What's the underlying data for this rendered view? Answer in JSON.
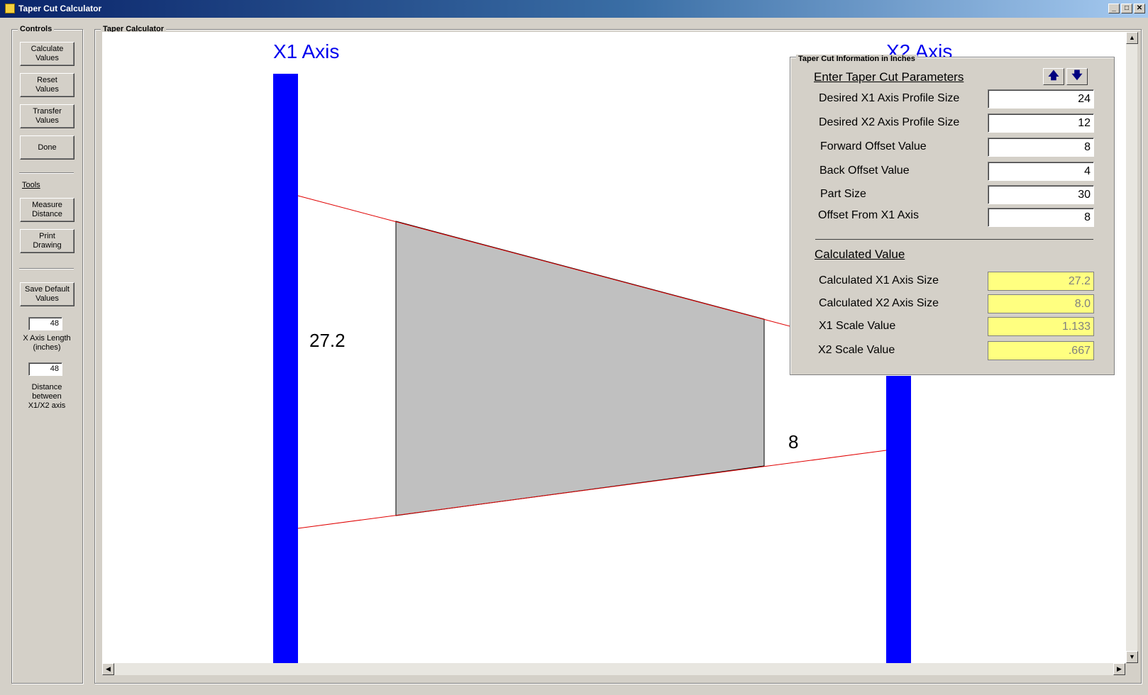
{
  "window": {
    "title": "Taper Cut Calculator"
  },
  "controls": {
    "group_title": "Controls",
    "calculate": "Calculate\nValues",
    "reset": "Reset\nValues",
    "transfer": "Transfer\nValues",
    "done": "Done",
    "tools_label": "Tools",
    "measure": "Measure\nDistance",
    "print": "Print\nDrawing",
    "save_default": "Save Default\nValues",
    "x_axis_length_value": "48",
    "x_axis_length_label": "X Axis Length\n(inches)",
    "distance_value": "48",
    "distance_label": "Distance\nbetween\nX1/X2 axis"
  },
  "calculator": {
    "group_title": "Taper Calculator",
    "x1_label": "X1 Axis",
    "x2_label": "X2 Axis",
    "x1_dimension": "27.2",
    "x2_dimension": "8"
  },
  "info": {
    "group_title": "Taper Cut Information in Inches",
    "params_heading": "Enter Taper Cut Parameters",
    "up_arrow": "🡅",
    "down_arrow": "🡇",
    "params": [
      {
        "label": "Desired X1 Axis Profile Size",
        "value": "24"
      },
      {
        "label": "Desired X2 Axis Profile Size",
        "value": "12"
      },
      {
        "label": "Forward Offset Value",
        "value": "8"
      },
      {
        "label": "Back Offset Value",
        "value": "4"
      },
      {
        "label": "Part Size",
        "value": "30"
      },
      {
        "label": "Offset From X1 Axis",
        "value": "8"
      }
    ],
    "calc_heading": "Calculated Value",
    "calculated": [
      {
        "label": "Calculated X1 Axis Size",
        "value": "27.2"
      },
      {
        "label": "Calculated X2 Axis Size",
        "value": "8.0"
      },
      {
        "label": "X1 Scale Value",
        "value": "1.133"
      },
      {
        "label": "X2 Scale Value",
        "value": ".667"
      }
    ]
  },
  "colors": {
    "axis": "#0000ff",
    "taper_line": "#e00000",
    "part_fill": "#c0c0c0",
    "calc_field": "#ffff80"
  }
}
